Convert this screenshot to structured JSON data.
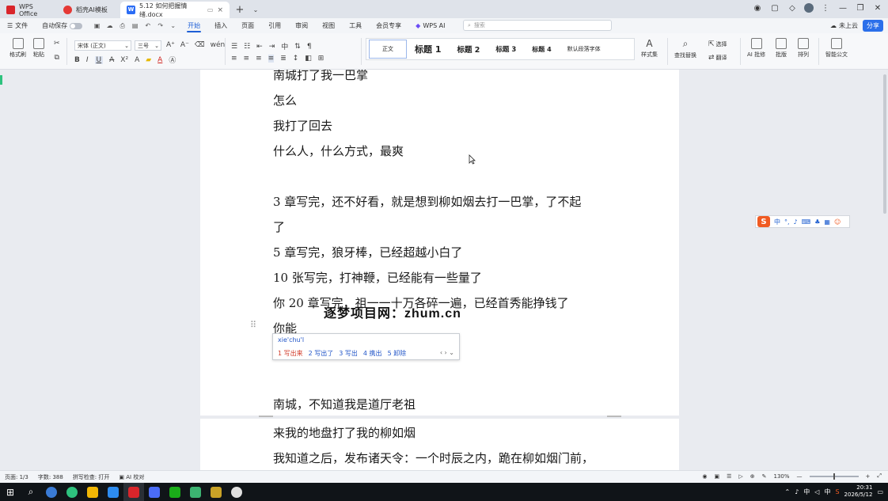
{
  "tabs": [
    {
      "label": "WPS Office",
      "icon": "wps-logo-icon"
    },
    {
      "label": "稻壳AI模板",
      "icon": "docer-logo-icon"
    },
    {
      "label": "5.12 如何把握情绪.docx",
      "icon": "word-doc-icon"
    }
  ],
  "menu": {
    "file": "文件",
    "autosave": "自动保存",
    "items": [
      "开始",
      "插入",
      "页面",
      "引用",
      "审阅",
      "视图",
      "工具",
      "会员专享"
    ],
    "active": "开始",
    "wps_ai": "WPS AI",
    "search_placeholder": "搜索",
    "cloud_status": "未上云",
    "share": "分享"
  },
  "ribbon": {
    "format_painter": "格式刷",
    "paste": "粘贴",
    "font_name": "宋体 (正文)",
    "font_size": "三号",
    "styles": [
      "正文",
      "标题 1",
      "标题 2",
      "标题 3",
      "标题 4",
      "默认段落字体"
    ],
    "style_set": "样式集",
    "find_replace": "查找替换",
    "select": "选择",
    "translate": "翻译",
    "ai_revise": "AI 批修",
    "layout": "批版",
    "arrange": "排列",
    "smart_doc": "智能公文"
  },
  "document": {
    "page1_lines": [
      "南城打了我一巴掌",
      "怎么",
      "我打了回去",
      "什么人，什么方式，最爽",
      "",
      "3 章写完，还不好看，就是想到柳如烟去打一巴掌，了不起",
      "了",
      "5 章写完，狼牙棒，已经超越小白了",
      "10 张写完，打神鞭，已经能有一些量了",
      "你 20 章写完，祖一一十万各碎一遍，已经首秀能挣钱了",
      "你能",
      "",
      "",
      "南城，不知道我是道厅老祖"
    ],
    "page2_lines": [
      "来我的地盘打了我的柳如烟",
      "我知道之后，发布诸天令：一个时辰之内，跪在柳如烟门前，"
    ],
    "watermark": "逐梦项目网：zhum.cn"
  },
  "ime": {
    "pinyin": "xie'chu'l",
    "candidates": [
      "1 写出来",
      "2 写出了",
      "3 写出",
      "4 携出",
      "5 卸除"
    ],
    "arrows": "‹ › ⌄"
  },
  "sogou_toolbar": {
    "lang": "中"
  },
  "statusbar": {
    "page": "页面: 1/3",
    "words": "字数: 388",
    "spell": "拼写检查: 打开",
    "ai_proof": "AI 校对",
    "zoom": "130%"
  },
  "taskbar": {
    "ime_lang": "中",
    "time": "20:31",
    "date": "2026/5/12"
  },
  "colors": {
    "accent": "#1e5fd6",
    "wps_red": "#d9252b",
    "page": "#ffffff",
    "workspace": "#e9ebf0",
    "taskbar": "#101418"
  }
}
